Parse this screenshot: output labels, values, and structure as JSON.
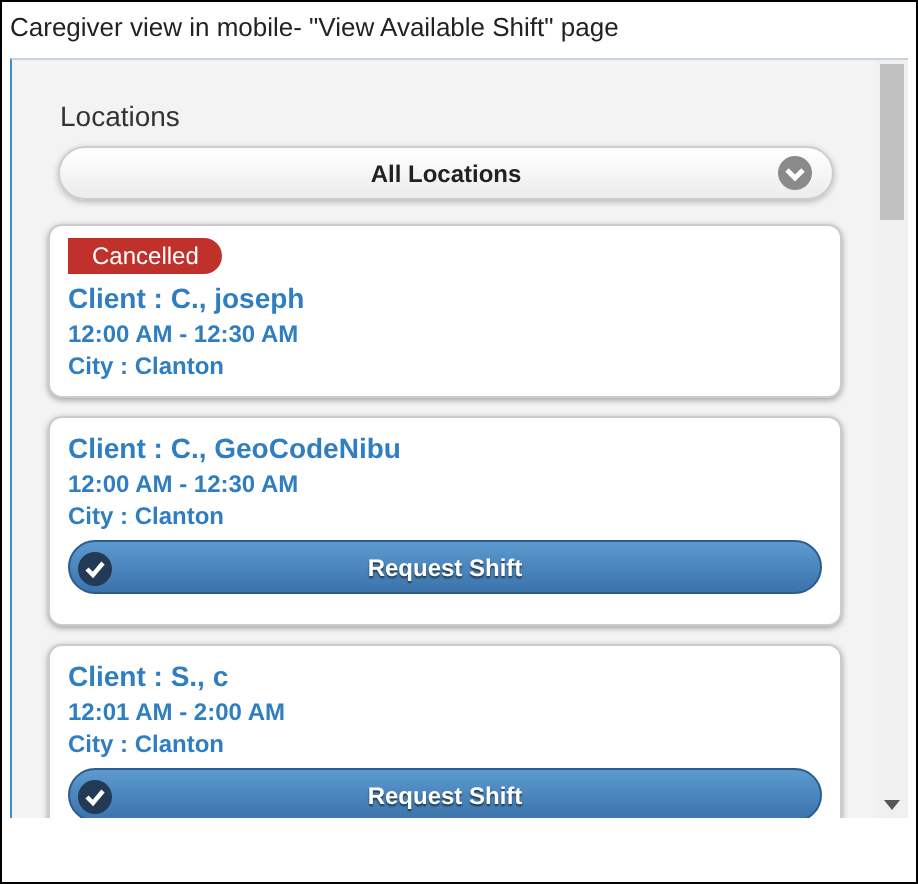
{
  "caption": "Caregiver view in mobile- \"View Available Shift\" page",
  "locations": {
    "label": "Locations",
    "value": "All Locations"
  },
  "shifts": [
    {
      "status": "Cancelled",
      "client": "Client : C., joseph",
      "time": "12:00 AM - 12:30 AM",
      "city": "City : Clanton"
    },
    {
      "client": "Client : C., GeoCodeNibu",
      "time": "12:00 AM - 12:30 AM",
      "city": "City : Clanton",
      "action": "Request Shift"
    },
    {
      "client": "Client : S., c",
      "time": "12:01 AM - 2:00 AM",
      "city": "City : Clanton",
      "action": "Request Shift"
    }
  ]
}
